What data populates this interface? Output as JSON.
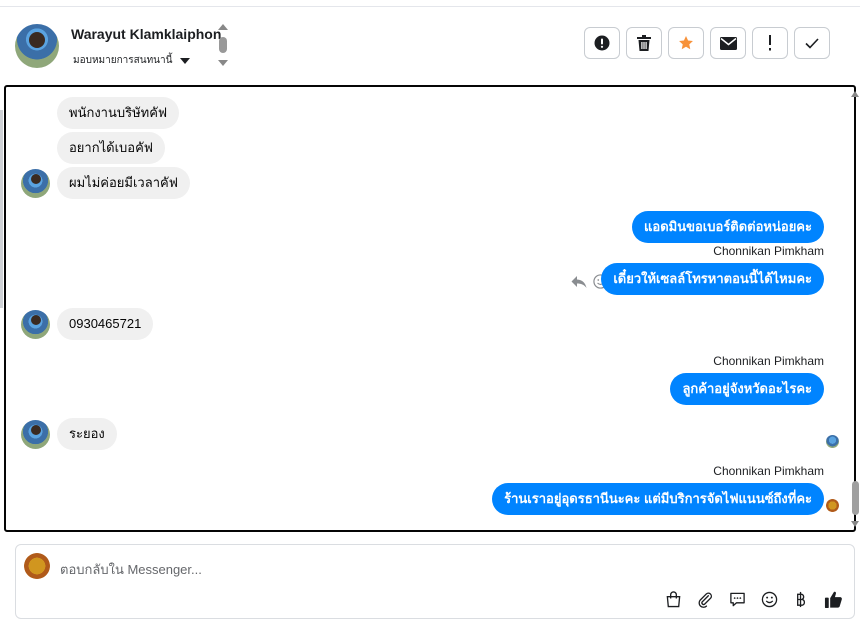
{
  "header": {
    "contact_name": "Warayut Klamklaiphon",
    "assign_label": "มอบหมายการสนทนานี้",
    "actions": [
      {
        "icon": "alert-circle-icon",
        "name": "mark-spam-button"
      },
      {
        "icon": "trash-icon",
        "name": "delete-button"
      },
      {
        "icon": "star-icon",
        "name": "star-button"
      },
      {
        "icon": "envelope-icon",
        "name": "mark-unread-button"
      },
      {
        "icon": "exclamation-icon",
        "name": "follow-up-button"
      },
      {
        "icon": "check-icon",
        "name": "mark-done-button"
      }
    ],
    "star_color": "#f7923a"
  },
  "messages": [
    {
      "dir": "in",
      "text": "พนักงานบริษัทคัฟ"
    },
    {
      "dir": "in",
      "text": "อยากได้เบอคัฟ"
    },
    {
      "dir": "in",
      "text": "ผมไม่ค่อยมีเวลาคัฟ"
    },
    {
      "dir": "out",
      "text": "แอดมินขอเบอร์ติดต่อหน่อยคะ"
    },
    {
      "dir": "out",
      "sender": "Chonnikan Pimkham",
      "text": "เดี๋ยวให้เซลล์โทรหาตอนนี้ได้ไหมคะ"
    },
    {
      "dir": "in",
      "text": "0930465721"
    },
    {
      "dir": "out",
      "sender": "Chonnikan Pimkham",
      "text": "ลูกค้าอยู่จังหวัดอะไรคะ"
    },
    {
      "dir": "in",
      "text": "ระยอง"
    },
    {
      "dir": "out",
      "sender": "Chonnikan Pimkham",
      "text": "ร้านเราอยู่อุดรธานีนะคะ แต่มีบริการจัดไฟแนนซ์ถึงที่คะ"
    }
  ],
  "composer": {
    "placeholder": "ตอบกลับใน Messenger..."
  },
  "colors": {
    "outgoing_bubble": "#0084ff",
    "incoming_bubble": "#f0f0f0"
  }
}
